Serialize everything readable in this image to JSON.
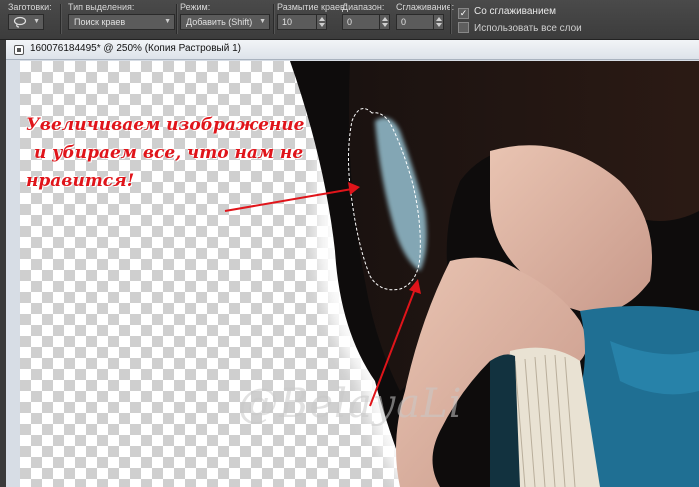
{
  "toolbar": {
    "presets": {
      "label": "Заготовки:"
    },
    "selection_type": {
      "label": "Тип выделения:",
      "value": "Поиск краев"
    },
    "mode": {
      "label": "Режим:",
      "value": "Добавить (Shift)"
    },
    "feather": {
      "label": "Размытие краев:",
      "value": "10"
    },
    "range": {
      "label": "Диапазон:",
      "value": "0"
    },
    "smoothing": {
      "label": "Сглаживание:",
      "value": "0"
    },
    "antialias": {
      "label": "Со сглаживанием",
      "checked": true
    },
    "use_all_layers": {
      "label": "Использовать все слои",
      "checked": false
    }
  },
  "document": {
    "title": "160076184495* @ 250% (Копия Растровый 1)"
  },
  "annotation": {
    "line1": "Увеличиваем изображение",
    "line2": "и убираем все, что нам не",
    "line3": "нравится!"
  },
  "watermark": "@BelayaLi",
  "colors": {
    "annotation_red": "#e0141a",
    "toolbar_bg": "#3c3c3c",
    "checker_dark": "#cfcfcf"
  },
  "icons": [
    "lasso-icon",
    "chevron-down-icon",
    "document-icon",
    "checkbox-checked-icon",
    "checkbox-icon"
  ]
}
